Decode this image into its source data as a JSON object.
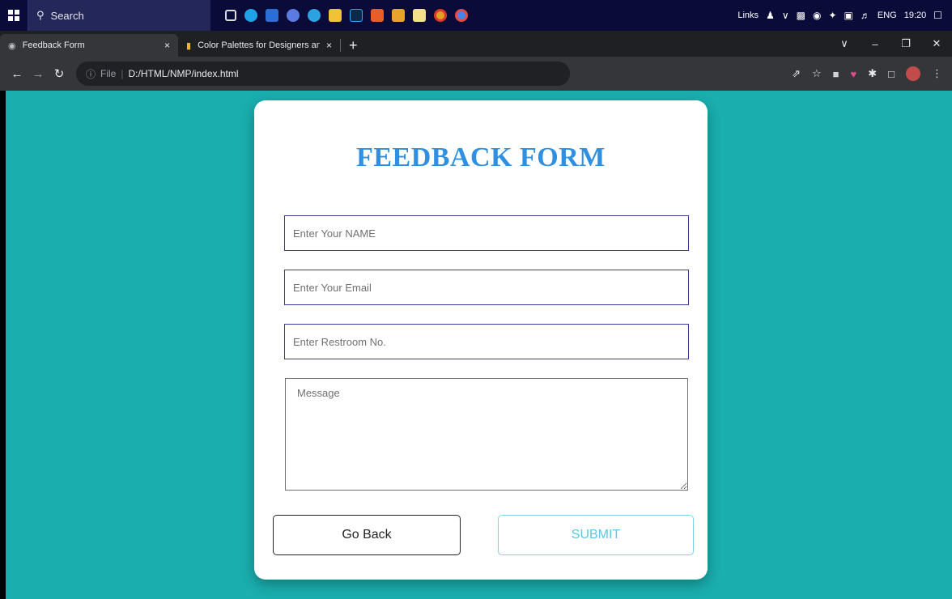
{
  "taskbar": {
    "search_label": "Search",
    "tray": {
      "links": "Links",
      "language": "ENG",
      "time": "19:20"
    }
  },
  "tabs": [
    {
      "title": "Feedback Form",
      "close": "×",
      "active": true
    },
    {
      "title": "Color Palettes for Designers and",
      "close": "×",
      "active": false
    }
  ],
  "new_tab": "+",
  "address": {
    "scheme": "File",
    "url": "D:/HTML/NMP/index.html"
  },
  "form": {
    "title": "FEEDBACK FORM",
    "name_placeholder": "Enter Your NAME",
    "email_placeholder": "Enter Your Email",
    "restroom_placeholder": "Enter Restroom No.",
    "message_placeholder": "Message",
    "back_label": "Go Back",
    "submit_label": "SUBMIT"
  },
  "colors": {
    "background": "#1aaeae",
    "title": "#2f8fe0",
    "input_border": "#3a3a9e",
    "submit": "#5cc7e2"
  }
}
